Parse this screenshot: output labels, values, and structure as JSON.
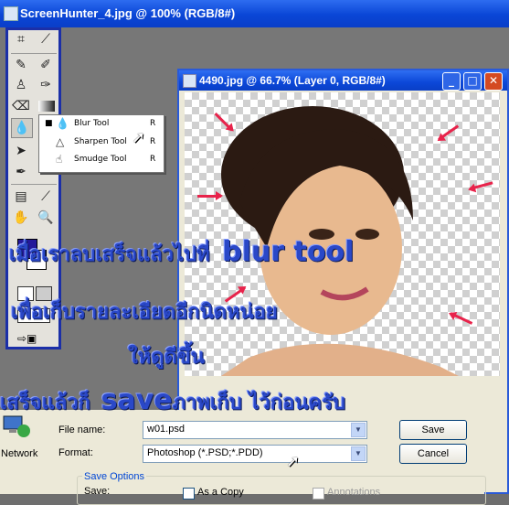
{
  "outer_window": {
    "title": "ScreenHunter_4.jpg @ 100% (RGB/8#)"
  },
  "toolbox": {
    "icons": [
      "crop-icon",
      "eyedropper-icon",
      "healing-brush-icon",
      "brush-icon",
      "clone-stamp-icon",
      "history-brush-icon",
      "eraser-icon",
      "gradient-icon",
      "blur-icon",
      "path-select-icon",
      "pen-icon",
      "notes-icon",
      "eyedropper-2-icon",
      "hand-icon",
      "zoom-icon"
    ],
    "foreground_color": "#24189a",
    "background_color": "#ffffff"
  },
  "flyout": {
    "items": [
      {
        "label": "Blur Tool",
        "key": "R",
        "active": true
      },
      {
        "label": "Sharpen Tool",
        "key": "R",
        "active": false
      },
      {
        "label": "Smudge Tool",
        "key": "R",
        "active": false
      }
    ]
  },
  "document_window": {
    "title": "4490.jpg @ 66.7% (Layer 0, RGB/8#)"
  },
  "overlay": {
    "line1": "เมื่อเราลบเสร็จแล้วไปที่",
    "line1_em": "blur tool",
    "line2": "เพื่อเก็บรายละเอียดอีกนิดหน่อย",
    "line3": "ให้ดูดีขึ้น",
    "line4_pre": "เสร็จแล้วก็",
    "line4_em": "save",
    "line4_post": "ภาพเก็บ ไว้ก่อนครับ"
  },
  "save_dialog": {
    "network_label": "Network",
    "file_name_label": "File name:",
    "file_name_value": "w01.psd",
    "format_label": "Format:",
    "format_value": "Photoshop (*.PSD;*.PDD)",
    "save_button": "Save",
    "cancel_button": "Cancel",
    "save_options_label": "Save Options",
    "save_label": "Save:",
    "as_copy_label": "As a Copy",
    "annotations_label": "Annotations"
  },
  "colors": {
    "title_bar": "#0a46d6",
    "overlay_text": "#2a48c8",
    "arrows": "#e8234b"
  }
}
